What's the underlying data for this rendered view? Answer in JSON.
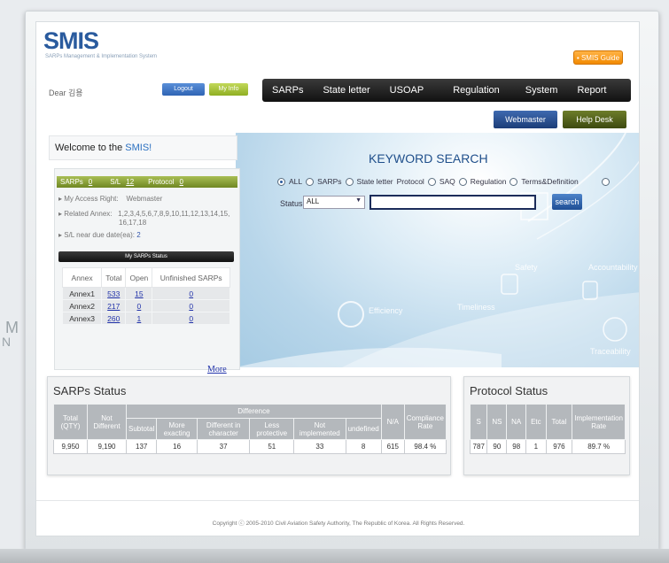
{
  "outside": {
    "left_text": "M",
    "left_text2": "N"
  },
  "header": {
    "logo": "SMIS",
    "logo_sub": "SARPs Management & Implementation System",
    "guide_button": "SMIS Guide",
    "dear": "Dear 김용",
    "logout": "Logout",
    "my_info": "My Info"
  },
  "nav": {
    "items": [
      "SARPs",
      "State letter",
      "USOAP",
      "Regulation",
      "System",
      "Report"
    ]
  },
  "quick": {
    "webmaster": "Webmaster",
    "help_desk": "Help Desk"
  },
  "welcome": {
    "prefix": "Welcome to the ",
    "brand": "SMIS!"
  },
  "account": {
    "sarps_label": "SARPs",
    "sarps_val": "0",
    "sl_label": "S/L",
    "sl_val": "12",
    "protocol_label": "Protocol",
    "protocol_val": "0",
    "access_label": "▸ My Access Right:",
    "access_val": "Webmaster",
    "annex_label": "▸ Related Annex:",
    "annex_val": "1,2,3,4,5,6,7,8,9,10,11,12,13,14,15,",
    "annex_val2": "16,17,18",
    "sl_due_label": "▸ S/L near due date(ea):",
    "sl_due_val": "2"
  },
  "my_sarps": {
    "title": "My SARPs Status",
    "headers": [
      "Annex",
      "Total",
      "Open",
      "Unfinished SARPs"
    ],
    "rows": [
      {
        "annex": "Annex1",
        "total": "533",
        "open": "15",
        "unf": "0"
      },
      {
        "annex": "Annex2",
        "total": "217",
        "open": "0",
        "unf": "0"
      },
      {
        "annex": "Annex3",
        "total": "260",
        "open": "1",
        "unf": "0"
      }
    ],
    "more": "More"
  },
  "keyword_search": {
    "title": "KEYWORD SEARCH",
    "radios": [
      "ALL",
      "SARPs",
      "State letter",
      "Protocol",
      "SAQ",
      "Regulation",
      "Terms&Definition"
    ],
    "status_label": "Status",
    "status_value": "ALL",
    "search_button": "search"
  },
  "hero_words": [
    "Efficiency",
    "Timeliness",
    "Safety",
    "Accountability",
    "Traceability"
  ],
  "sarps_status": {
    "title": "SARPs Status",
    "h_total": "Total (QTY)",
    "h_notdiff": "Not Different",
    "h_difference": "Difference",
    "h_subtotal": "Subtotal",
    "h_more": "More exacting",
    "h_diffchar": "Different in character",
    "h_less": "Less protective",
    "h_notimpl": "Not implemented",
    "h_undef": "undefined",
    "h_na": "N/A",
    "h_compl": "Compliance Rate",
    "values": [
      "9,950",
      "9,190",
      "137",
      "16",
      "37",
      "51",
      "33",
      "8",
      "615",
      "98.4 %"
    ]
  },
  "protocol_status": {
    "title": "Protocol Status",
    "headers": [
      "S",
      "NS",
      "NA",
      "Etc",
      "Total",
      "Implementation Rate"
    ],
    "values": [
      "787",
      "90",
      "98",
      "1",
      "976",
      "89.7 %"
    ]
  },
  "footer": {
    "copyright": "Copyright ⓒ 2005-2010 Civil Aviation Safety Authority, The Republic of Korea. All Rights Reserved."
  }
}
